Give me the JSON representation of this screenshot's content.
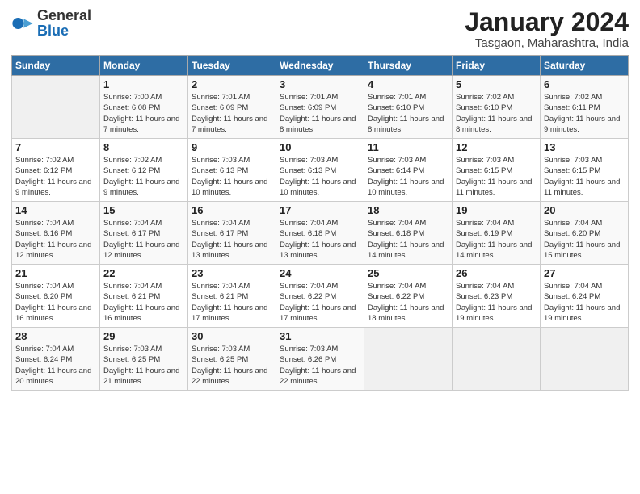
{
  "header": {
    "logo_general": "General",
    "logo_blue": "Blue",
    "month_year": "January 2024",
    "location": "Tasgaon, Maharashtra, India"
  },
  "days_of_week": [
    "Sunday",
    "Monday",
    "Tuesday",
    "Wednesday",
    "Thursday",
    "Friday",
    "Saturday"
  ],
  "weeks": [
    [
      {
        "day": "",
        "info": ""
      },
      {
        "day": "1",
        "sunrise": "7:00 AM",
        "sunset": "6:08 PM",
        "daylight": "11 hours and 7 minutes."
      },
      {
        "day": "2",
        "sunrise": "7:01 AM",
        "sunset": "6:09 PM",
        "daylight": "11 hours and 7 minutes."
      },
      {
        "day": "3",
        "sunrise": "7:01 AM",
        "sunset": "6:09 PM",
        "daylight": "11 hours and 8 minutes."
      },
      {
        "day": "4",
        "sunrise": "7:01 AM",
        "sunset": "6:10 PM",
        "daylight": "11 hours and 8 minutes."
      },
      {
        "day": "5",
        "sunrise": "7:02 AM",
        "sunset": "6:10 PM",
        "daylight": "11 hours and 8 minutes."
      },
      {
        "day": "6",
        "sunrise": "7:02 AM",
        "sunset": "6:11 PM",
        "daylight": "11 hours and 9 minutes."
      }
    ],
    [
      {
        "day": "7",
        "sunrise": "7:02 AM",
        "sunset": "6:12 PM",
        "daylight": "11 hours and 9 minutes."
      },
      {
        "day": "8",
        "sunrise": "7:02 AM",
        "sunset": "6:12 PM",
        "daylight": "11 hours and 9 minutes."
      },
      {
        "day": "9",
        "sunrise": "7:03 AM",
        "sunset": "6:13 PM",
        "daylight": "11 hours and 10 minutes."
      },
      {
        "day": "10",
        "sunrise": "7:03 AM",
        "sunset": "6:13 PM",
        "daylight": "11 hours and 10 minutes."
      },
      {
        "day": "11",
        "sunrise": "7:03 AM",
        "sunset": "6:14 PM",
        "daylight": "11 hours and 10 minutes."
      },
      {
        "day": "12",
        "sunrise": "7:03 AM",
        "sunset": "6:15 PM",
        "daylight": "11 hours and 11 minutes."
      },
      {
        "day": "13",
        "sunrise": "7:03 AM",
        "sunset": "6:15 PM",
        "daylight": "11 hours and 11 minutes."
      }
    ],
    [
      {
        "day": "14",
        "sunrise": "7:04 AM",
        "sunset": "6:16 PM",
        "daylight": "11 hours and 12 minutes."
      },
      {
        "day": "15",
        "sunrise": "7:04 AM",
        "sunset": "6:17 PM",
        "daylight": "11 hours and 12 minutes."
      },
      {
        "day": "16",
        "sunrise": "7:04 AM",
        "sunset": "6:17 PM",
        "daylight": "11 hours and 13 minutes."
      },
      {
        "day": "17",
        "sunrise": "7:04 AM",
        "sunset": "6:18 PM",
        "daylight": "11 hours and 13 minutes."
      },
      {
        "day": "18",
        "sunrise": "7:04 AM",
        "sunset": "6:18 PM",
        "daylight": "11 hours and 14 minutes."
      },
      {
        "day": "19",
        "sunrise": "7:04 AM",
        "sunset": "6:19 PM",
        "daylight": "11 hours and 14 minutes."
      },
      {
        "day": "20",
        "sunrise": "7:04 AM",
        "sunset": "6:20 PM",
        "daylight": "11 hours and 15 minutes."
      }
    ],
    [
      {
        "day": "21",
        "sunrise": "7:04 AM",
        "sunset": "6:20 PM",
        "daylight": "11 hours and 16 minutes."
      },
      {
        "day": "22",
        "sunrise": "7:04 AM",
        "sunset": "6:21 PM",
        "daylight": "11 hours and 16 minutes."
      },
      {
        "day": "23",
        "sunrise": "7:04 AM",
        "sunset": "6:21 PM",
        "daylight": "11 hours and 17 minutes."
      },
      {
        "day": "24",
        "sunrise": "7:04 AM",
        "sunset": "6:22 PM",
        "daylight": "11 hours and 17 minutes."
      },
      {
        "day": "25",
        "sunrise": "7:04 AM",
        "sunset": "6:22 PM",
        "daylight": "11 hours and 18 minutes."
      },
      {
        "day": "26",
        "sunrise": "7:04 AM",
        "sunset": "6:23 PM",
        "daylight": "11 hours and 19 minutes."
      },
      {
        "day": "27",
        "sunrise": "7:04 AM",
        "sunset": "6:24 PM",
        "daylight": "11 hours and 19 minutes."
      }
    ],
    [
      {
        "day": "28",
        "sunrise": "7:04 AM",
        "sunset": "6:24 PM",
        "daylight": "11 hours and 20 minutes."
      },
      {
        "day": "29",
        "sunrise": "7:03 AM",
        "sunset": "6:25 PM",
        "daylight": "11 hours and 21 minutes."
      },
      {
        "day": "30",
        "sunrise": "7:03 AM",
        "sunset": "6:25 PM",
        "daylight": "11 hours and 22 minutes."
      },
      {
        "day": "31",
        "sunrise": "7:03 AM",
        "sunset": "6:26 PM",
        "daylight": "11 hours and 22 minutes."
      },
      {
        "day": "",
        "info": ""
      },
      {
        "day": "",
        "info": ""
      },
      {
        "day": "",
        "info": ""
      }
    ]
  ]
}
